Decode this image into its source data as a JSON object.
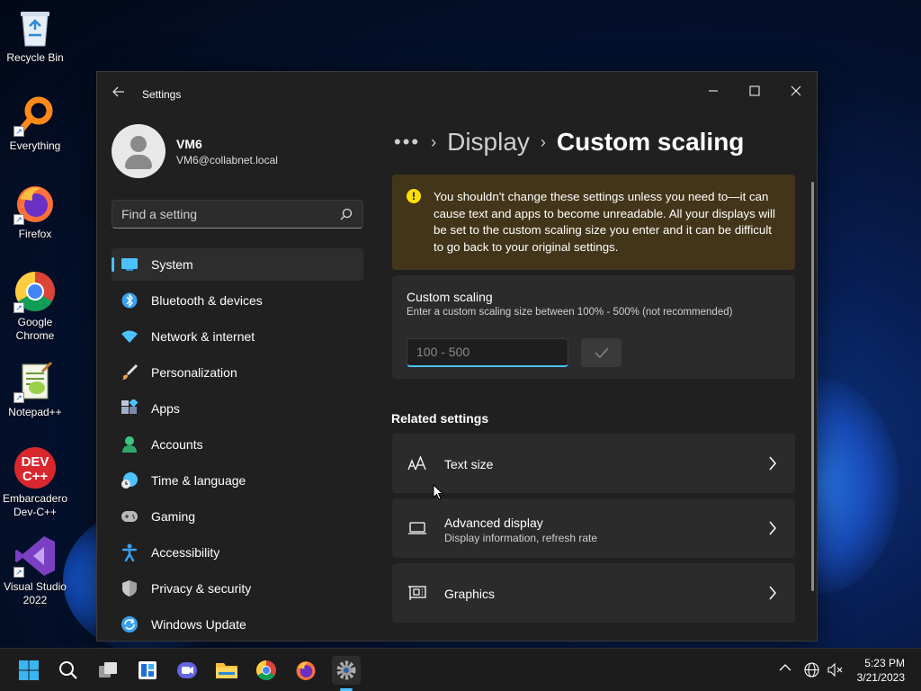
{
  "desktop": {
    "icons": [
      {
        "label": "Recycle Bin"
      },
      {
        "label": "Everything"
      },
      {
        "label": "Firefox"
      },
      {
        "label": "Google Chrome"
      },
      {
        "label": "Notepad++"
      },
      {
        "label": "Embarcadero Dev-C++"
      },
      {
        "label": "Visual Studio 2022"
      }
    ]
  },
  "window": {
    "app_title": "Settings",
    "controls": {
      "minimize": "—",
      "maximize": "☐",
      "close": "✕"
    }
  },
  "profile": {
    "name": "VM6",
    "email": "VM6@collabnet.local"
  },
  "search": {
    "placeholder": "Find a setting"
  },
  "nav": {
    "selected": "System",
    "items": [
      {
        "label": "System",
        "icon": "system-icon",
        "color": "#4cc2ff"
      },
      {
        "label": "Bluetooth & devices",
        "icon": "bluetooth-icon",
        "color": "#3aa0f0"
      },
      {
        "label": "Network & internet",
        "icon": "wifi-icon",
        "color": "#4cc2ff"
      },
      {
        "label": "Personalization",
        "icon": "brush-icon",
        "color": "#f0a050"
      },
      {
        "label": "Apps",
        "icon": "apps-icon",
        "color": "#9fb0c8"
      },
      {
        "label": "Accounts",
        "icon": "accounts-icon",
        "color": "#3fc380"
      },
      {
        "label": "Time & language",
        "icon": "clock-globe-icon",
        "color": "#4cc2ff"
      },
      {
        "label": "Gaming",
        "icon": "gamepad-icon",
        "color": "#b8b8b8"
      },
      {
        "label": "Accessibility",
        "icon": "accessibility-icon",
        "color": "#3aa0f0"
      },
      {
        "label": "Privacy & security",
        "icon": "shield-icon",
        "color": "#a0a0a0"
      },
      {
        "label": "Windows Update",
        "icon": "update-icon",
        "color": "#3aa0f0"
      }
    ]
  },
  "breadcrumb": {
    "dots": "•••",
    "parent": "Display",
    "current": "Custom scaling"
  },
  "warning": {
    "text": "You shouldn't change these settings unless you need to—it can cause text and apps to become unreadable. All your displays will be set to the custom scaling size you enter and it can be difficult to go back to your original settings."
  },
  "custom_scaling": {
    "title": "Custom scaling",
    "subtitle": "Enter a custom scaling size between 100% - 500% (not recommended)",
    "input_placeholder": "100 - 500",
    "input_value": ""
  },
  "related": {
    "heading": "Related settings",
    "items": [
      {
        "label": "Text size",
        "sub": ""
      },
      {
        "label": "Advanced display",
        "sub": "Display information, refresh rate"
      },
      {
        "label": "Graphics",
        "sub": ""
      }
    ]
  },
  "taskbar": {
    "clock_time": "5:23 PM",
    "clock_date": "3/21/2023"
  },
  "colors": {
    "accent": "#4cc2ff",
    "warning_bg": "#433519",
    "warning_icon": "#fce100"
  }
}
